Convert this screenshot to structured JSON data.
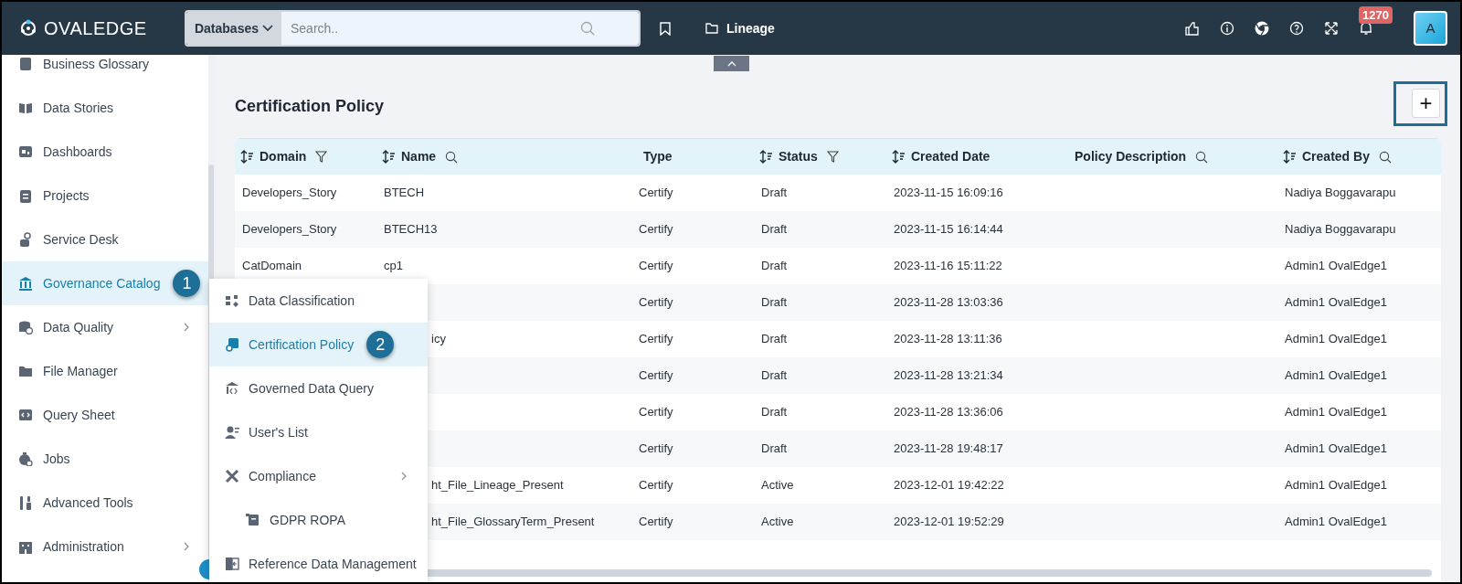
{
  "topbar": {
    "logo": "OVALEDGE",
    "search": {
      "scope": "Databases",
      "placeholder": "Search.."
    },
    "breadcrumb": "Lineage",
    "notification_count": "1270",
    "avatar": "A"
  },
  "sidebar": {
    "items": [
      {
        "label": "Business Glossary",
        "selected": false,
        "has_submenu": false
      },
      {
        "label": "Data Stories",
        "selected": false,
        "has_submenu": false
      },
      {
        "label": "Dashboards",
        "selected": false,
        "has_submenu": false
      },
      {
        "label": "Projects",
        "selected": false,
        "has_submenu": false
      },
      {
        "label": "Service Desk",
        "selected": false,
        "has_submenu": false
      },
      {
        "label": "Governance Catalog",
        "selected": true,
        "has_submenu": false,
        "callout": "1"
      },
      {
        "label": "Data Quality",
        "selected": false,
        "has_submenu": true
      },
      {
        "label": "File Manager",
        "selected": false,
        "has_submenu": false
      },
      {
        "label": "Query Sheet",
        "selected": false,
        "has_submenu": false
      },
      {
        "label": "Jobs",
        "selected": false,
        "has_submenu": false
      },
      {
        "label": "Advanced Tools",
        "selected": false,
        "has_submenu": false
      },
      {
        "label": "Administration",
        "selected": false,
        "has_submenu": true
      }
    ]
  },
  "submenu": {
    "items": [
      {
        "label": "Data Classification",
        "selected": false,
        "has_submenu": false
      },
      {
        "label": "Certification Policy",
        "selected": true,
        "has_submenu": false,
        "callout": "2"
      },
      {
        "label": "Governed Data Query",
        "selected": false,
        "has_submenu": false
      },
      {
        "label": "User's List",
        "selected": false,
        "has_submenu": false
      },
      {
        "label": "Compliance",
        "selected": false,
        "has_submenu": true,
        "children": [
          {
            "label": "GDPR ROPA",
            "selected": false,
            "has_submenu": false
          }
        ]
      },
      {
        "label": "Reference Data Management",
        "selected": false,
        "has_submenu": false
      }
    ]
  },
  "page": {
    "title": "Certification Policy",
    "add_button": {
      "label": "+",
      "highlighted": true
    }
  },
  "table": {
    "columns": [
      {
        "label": "Domain",
        "sortable": true,
        "filterable": true,
        "searchable": false
      },
      {
        "label": "Name",
        "sortable": true,
        "filterable": false,
        "searchable": true
      },
      {
        "label": "Type",
        "sortable": false,
        "filterable": false,
        "searchable": false
      },
      {
        "label": "Status",
        "sortable": true,
        "filterable": true,
        "searchable": false
      },
      {
        "label": "Created Date",
        "sortable": true,
        "filterable": false,
        "searchable": false
      },
      {
        "label": "Policy Description",
        "sortable": false,
        "filterable": false,
        "searchable": true
      },
      {
        "label": "Created By",
        "sortable": true,
        "filterable": false,
        "searchable": true
      }
    ],
    "rows": [
      {
        "covered": false,
        "domain": "Developers_Story",
        "name": "BTECH",
        "type": "Certify",
        "status": "Draft",
        "created_date": "2023-11-15 16:09:16",
        "created_by": "Nadiya Boggavarapu"
      },
      {
        "covered": false,
        "domain": "Developers_Story",
        "name": "BTECH13",
        "type": "Certify",
        "status": "Draft",
        "created_date": "2023-11-15 16:14:44",
        "created_by": "Nadiya Boggavarapu"
      },
      {
        "covered": false,
        "domain": "CatDomain",
        "name": "cp1",
        "type": "Certify",
        "status": "Draft",
        "created_date": "2023-11-16 15:11:22",
        "created_by": "Admin1 OvalEdge1"
      },
      {
        "type": "Certify",
        "status": "Draft",
        "created_date": "2023-11-28 13:03:36",
        "created_by": "Admin1 OvalEdge1"
      },
      {
        "covered": true,
        "name": "icy",
        "type": "Certify",
        "status": "Draft",
        "created_date": "2023-11-28 13:11:36",
        "created_by": "Admin1 OvalEdge1"
      },
      {
        "type": "Certify",
        "status": "Draft",
        "created_date": "2023-11-28 13:21:34",
        "created_by": "Admin1 OvalEdge1"
      },
      {
        "type": "Certify",
        "status": "Draft",
        "created_date": "2023-11-28 13:36:06",
        "created_by": "Admin1 OvalEdge1"
      },
      {
        "type": "Certify",
        "status": "Draft",
        "created_date": "2023-11-28 19:48:17",
        "created_by": "Admin1 OvalEdge1"
      },
      {
        "covered": true,
        "name": "ht_File_Lineage_Present",
        "type": "Certify",
        "status": "Active",
        "created_date": "2023-12-01 19:42:22",
        "created_by": "Admin1 OvalEdge1"
      },
      {
        "covered": true,
        "name": "ht_File_GlossaryTerm_Present",
        "type": "Certify",
        "status": "Active",
        "created_date": "2023-12-01 19:52:29",
        "created_by": "Admin1 OvalEdge1"
      }
    ]
  }
}
